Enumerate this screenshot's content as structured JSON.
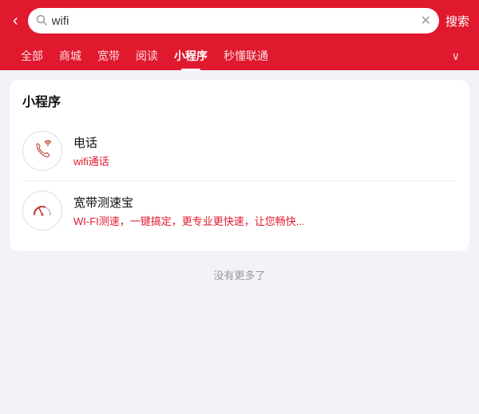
{
  "header": {
    "back_icon": "‹",
    "search_value": "wifi",
    "clear_icon": "✕",
    "search_btn_label": "搜索",
    "accent_color": "#e0192e"
  },
  "tabs": {
    "items": [
      {
        "label": "全部",
        "active": false
      },
      {
        "label": "商城",
        "active": false
      },
      {
        "label": "宽带",
        "active": false
      },
      {
        "label": "阅读",
        "active": false
      },
      {
        "label": "小程序",
        "active": true
      },
      {
        "label": "秒懂联通",
        "active": false
      }
    ],
    "more_icon": "∨"
  },
  "main": {
    "section_title": "小程序",
    "items": [
      {
        "name": "电话",
        "desc": "wifi通话",
        "icon_type": "phone-wifi"
      },
      {
        "name": "宽带测速宝",
        "desc": "WI-FI测速，一键搞定，更专业更快速，让您畅快...",
        "icon_type": "speedometer"
      }
    ],
    "no_more_label": "没有更多了"
  }
}
